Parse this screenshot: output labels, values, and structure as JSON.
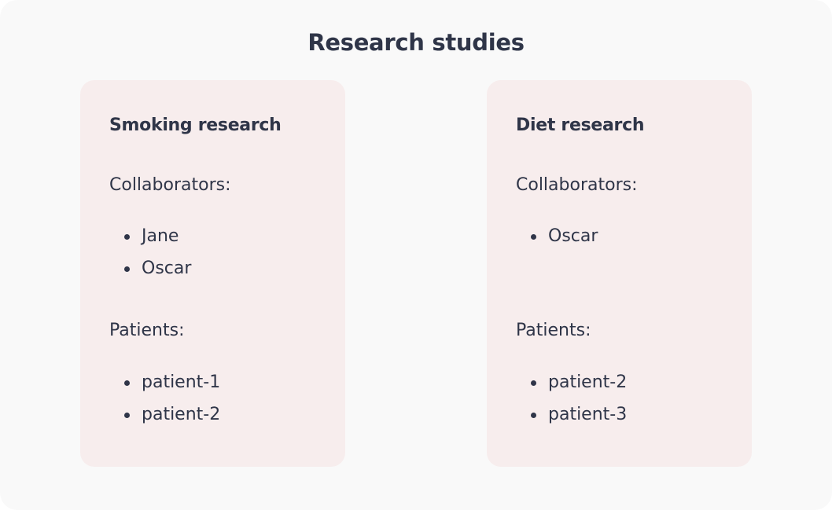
{
  "page": {
    "title": "Research studies"
  },
  "studies": [
    {
      "title": "Smoking research",
      "collaborators_label": "Collaborators:",
      "collaborators": [
        "Jane",
        "Oscar"
      ],
      "patients_label": "Patients:",
      "patients": [
        "patient-1",
        "patient-2"
      ]
    },
    {
      "title": "Diet research",
      "collaborators_label": "Collaborators:",
      "collaborators": [
        "Oscar"
      ],
      "patients_label": "Patients:",
      "patients": [
        "patient-2",
        "patient-3"
      ]
    }
  ],
  "colors": {
    "background": "#f9f9f9",
    "card": "#f7eded",
    "text": "#2f3548"
  }
}
